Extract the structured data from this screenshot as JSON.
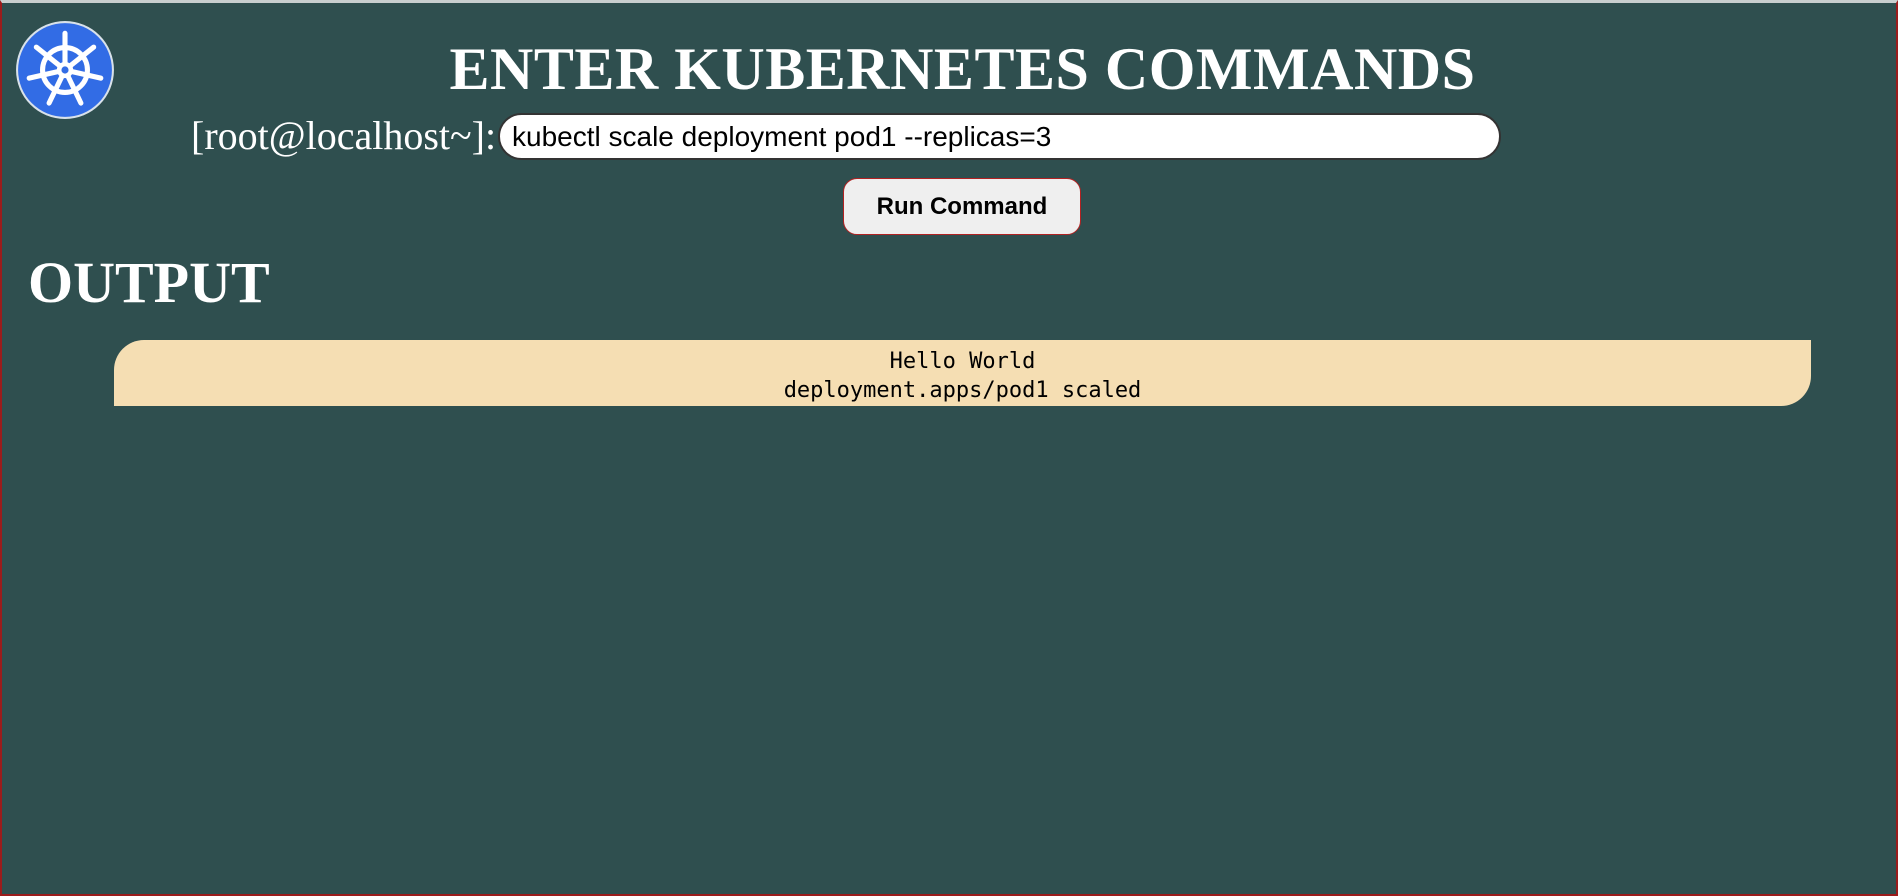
{
  "header": {
    "title": "ENTER KUBERNETES COMMANDS",
    "logo_icon": "kubernetes-helm-wheel-icon",
    "logo_color": "#326ce5"
  },
  "command": {
    "prompt": "[root@localhost~]:",
    "value": "kubectl scale deployment pod1 --replicas=3",
    "run_label": "Run Command"
  },
  "output": {
    "heading": "OUTPUT",
    "lines": [
      "Hello World",
      "deployment.apps/pod1 scaled"
    ]
  },
  "colors": {
    "background": "#2f4f4f",
    "output_background": "#f5deb3",
    "button_border": "#b22222"
  }
}
